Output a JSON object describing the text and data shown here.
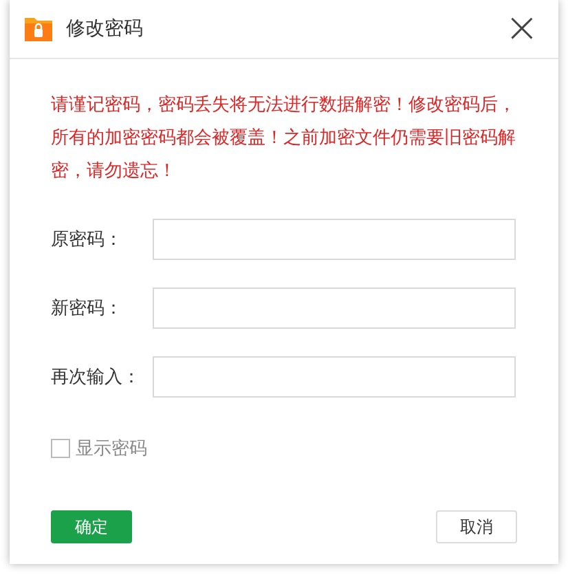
{
  "window": {
    "title": "修改密码",
    "close": "×"
  },
  "warning": "请谨记密码，密码丢失将无法进行数据解密！修改密码后，所有的加密密码都会被覆盖！之前加密文件仍需要旧密码解密，请勿遗忘！",
  "fields": [
    {
      "label": "原密码："
    },
    {
      "label": "新密码："
    },
    {
      "label": "再次输入："
    }
  ],
  "show_password": {
    "label": "显示密码",
    "checked": false
  },
  "buttons": [
    {
      "label": "确定",
      "kind": "primary"
    },
    {
      "label": "取消",
      "kind": "secondary"
    }
  ]
}
